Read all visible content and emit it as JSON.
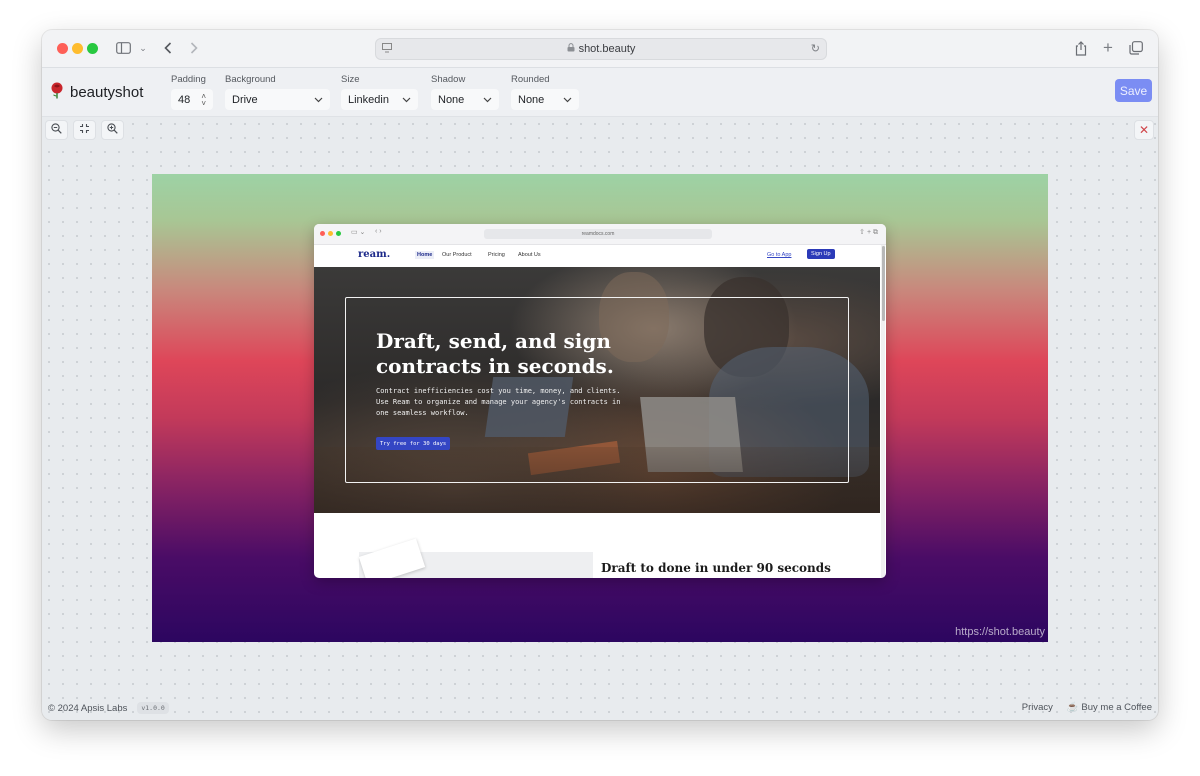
{
  "browser": {
    "url": "shot.beauty"
  },
  "app": {
    "brand": "beautyshot",
    "save_label": "Save",
    "controls": {
      "padding": {
        "label": "Padding",
        "value": "48"
      },
      "background": {
        "label": "Background",
        "value": "Drive"
      },
      "size": {
        "label": "Size",
        "value": "Linkedin"
      },
      "shadow": {
        "label": "Shadow",
        "value": "None"
      },
      "rounded": {
        "label": "Rounded",
        "value": "None"
      }
    },
    "watermark": "https://shot.beauty",
    "footer": {
      "copyright": "© 2024 Apsis Labs",
      "version": "v1.0.0",
      "privacy": "Privacy",
      "coffee": "Buy me a Coffee"
    }
  },
  "preview": {
    "url": "reamdocs.com",
    "logo": "ream.",
    "nav": [
      "Home",
      "Our Product",
      "Pricing",
      "About Us"
    ],
    "go_to_app": "Go to App",
    "sign_up": "Sign Up",
    "hero_title": "Draft, send, and sign contracts in seconds.",
    "hero_text": "Contract inefficiencies cost you time, money, and clients. Use Ream to organize and manage your agency's contracts in one seamless workflow.",
    "hero_button": "Try free for 30 days",
    "section_title": "Draft to done in under 90 seconds"
  },
  "colors": {
    "save_button": "#7b8df3",
    "accent_blue": "#3446c4",
    "logo_red": "#d0454a"
  },
  "icons": [
    "sidebar-icon",
    "back-icon",
    "forward-icon",
    "lock-icon",
    "reload-icon",
    "share-icon",
    "plus-icon",
    "tabs-icon",
    "zoom-out-icon",
    "fit-icon",
    "zoom-in-icon",
    "close-icon"
  ]
}
